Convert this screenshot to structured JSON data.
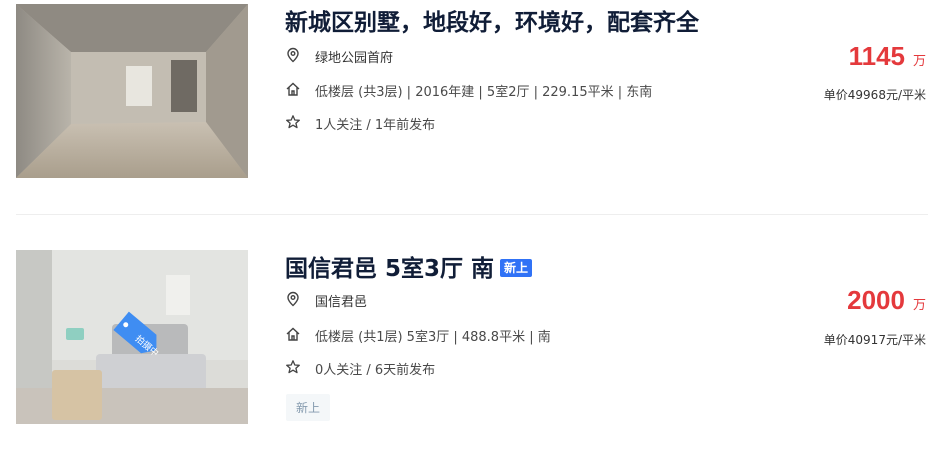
{
  "listings": [
    {
      "title": "新城区别墅，地段好，环境好，配套齐全",
      "badge": "",
      "community": "绿地公园首府",
      "house_info": "低楼层 (共3层) | 2016年建 | 5室2厅 | 229.15平米 | 东南",
      "follow_info": "1人关注 / 1年前发布",
      "total_price": "1145",
      "price_unit": "万",
      "unit_price": "单价49968元/平米",
      "tags": []
    },
    {
      "title": "国信君邑 5室3厅 南",
      "badge": "新上",
      "community": "国信君邑",
      "house_info": "低楼层 (共1层) 5室3厅 | 488.8平米 | 南",
      "follow_info": "0人关注 / 6天前发布",
      "total_price": "2000",
      "price_unit": "万",
      "unit_price": "单价40917元/平米",
      "tags": [
        "新上"
      ],
      "image_overlay_label": "拍摄中"
    }
  ],
  "icons": {
    "location": "location-pin-icon",
    "house": "house-icon",
    "follow": "star-icon"
  },
  "colors": {
    "price": "#e4393c",
    "badge": "#3072f6",
    "title": "#101d37",
    "tag_bg": "#f4f7f9",
    "tag_text": "#849aae"
  }
}
